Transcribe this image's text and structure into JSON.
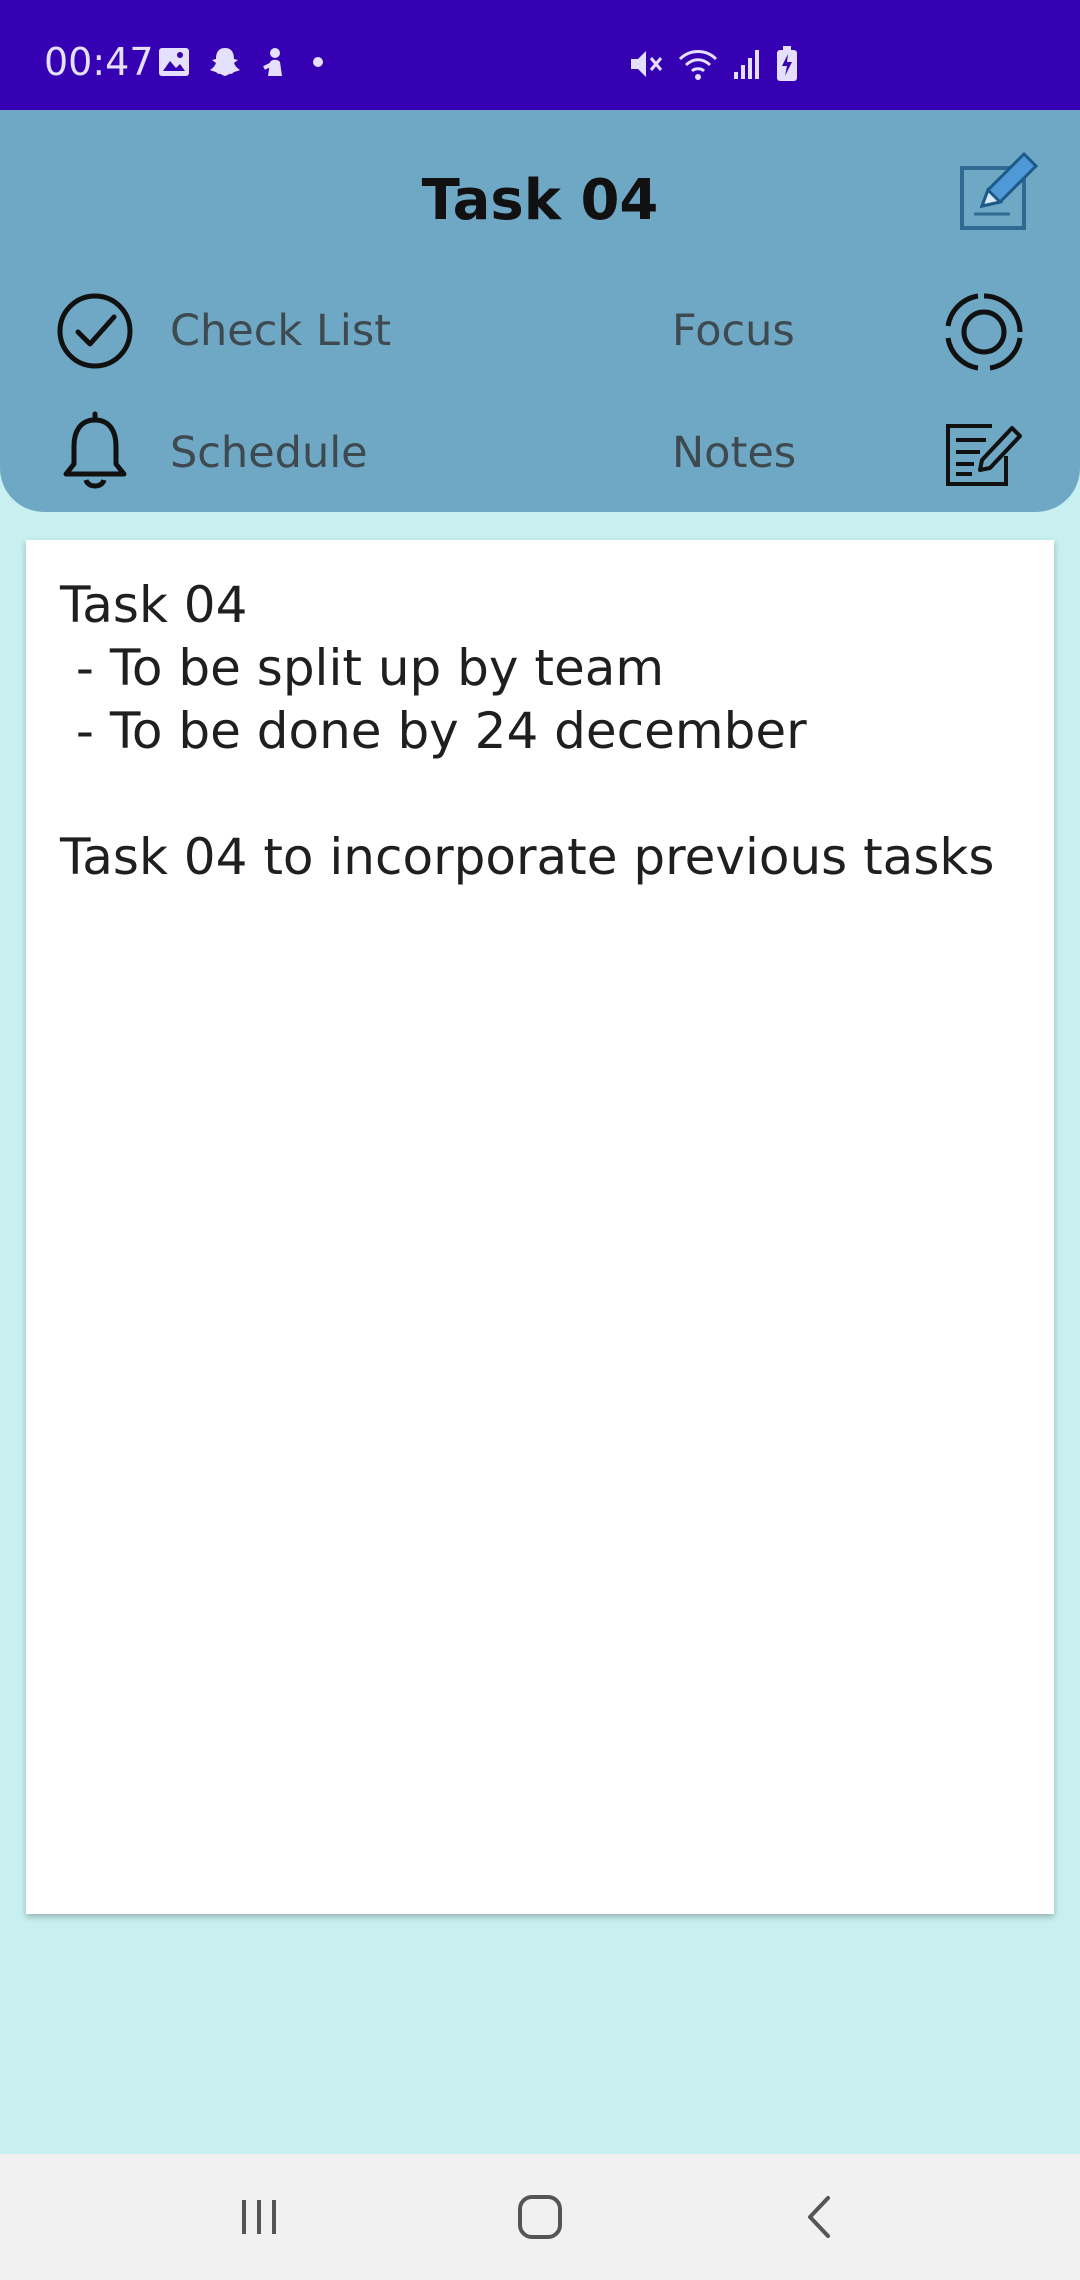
{
  "status_bar": {
    "time": "00:47",
    "left_icons": [
      "gallery-icon",
      "snapchat-icon",
      "assistant-icon",
      "dot-icon"
    ],
    "right_icons": [
      "mute-icon",
      "wifi-icon",
      "signal-icon",
      "battery-charging-icon"
    ]
  },
  "header": {
    "title": "Task 04",
    "edit_icon": "edit-note-icon",
    "menu": [
      {
        "label": "Check List",
        "icon": "check-circle-icon"
      },
      {
        "label": "Focus",
        "icon": "focus-ring-icon"
      },
      {
        "label": "Schedule",
        "icon": "bell-icon"
      },
      {
        "label": "Notes",
        "icon": "notes-pencil-icon"
      }
    ]
  },
  "note": {
    "text": "Task 04\n - To be split up by team\n - To be done by 24 december\n\nTask 04 to incorporate previous tasks"
  },
  "nav_bar": {
    "buttons": [
      "recent-apps-icon",
      "home-icon",
      "back-icon"
    ]
  },
  "colors": {
    "status_bar": "#3600b3",
    "header": "#6fa8c4",
    "background": "#c8f0f0",
    "card": "#ffffff"
  }
}
